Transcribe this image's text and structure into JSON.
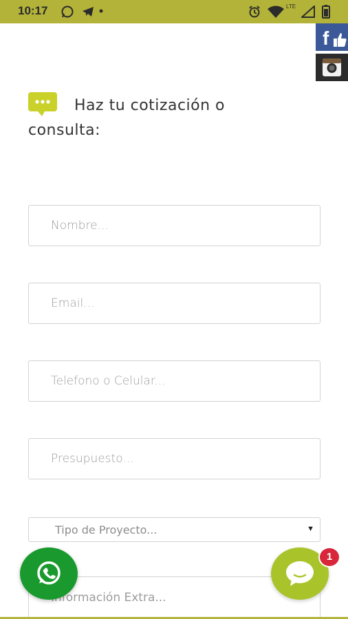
{
  "status_bar": {
    "time": "10:17",
    "network_label": "LTE",
    "icons": [
      "whatsapp-icon",
      "telegram-icon",
      "dot-icon",
      "alarm-icon",
      "wifi-icon",
      "signal-icon",
      "battery-icon"
    ]
  },
  "social": {
    "icons": [
      "facebook-like-icon",
      "instagram-icon"
    ]
  },
  "form": {
    "heading": "Haz tu cotización o consulta:",
    "fields": {
      "nombre": {
        "placeholder": "Nombre..."
      },
      "email": {
        "placeholder": "Email..."
      },
      "telefono": {
        "placeholder": "Telefono o Celular..."
      },
      "presupuesto": {
        "placeholder": "Presupuesto..."
      },
      "tipo": {
        "selected": "Tipo de Proyecto..."
      },
      "extra": {
        "placeholder": "Información Extra..."
      }
    }
  },
  "chat": {
    "badge_count": "1"
  },
  "colors": {
    "accent": "#b3b33a",
    "whatsapp": "#1a9a2e",
    "chat": "#a9c42a",
    "badge": "#d8263a"
  }
}
